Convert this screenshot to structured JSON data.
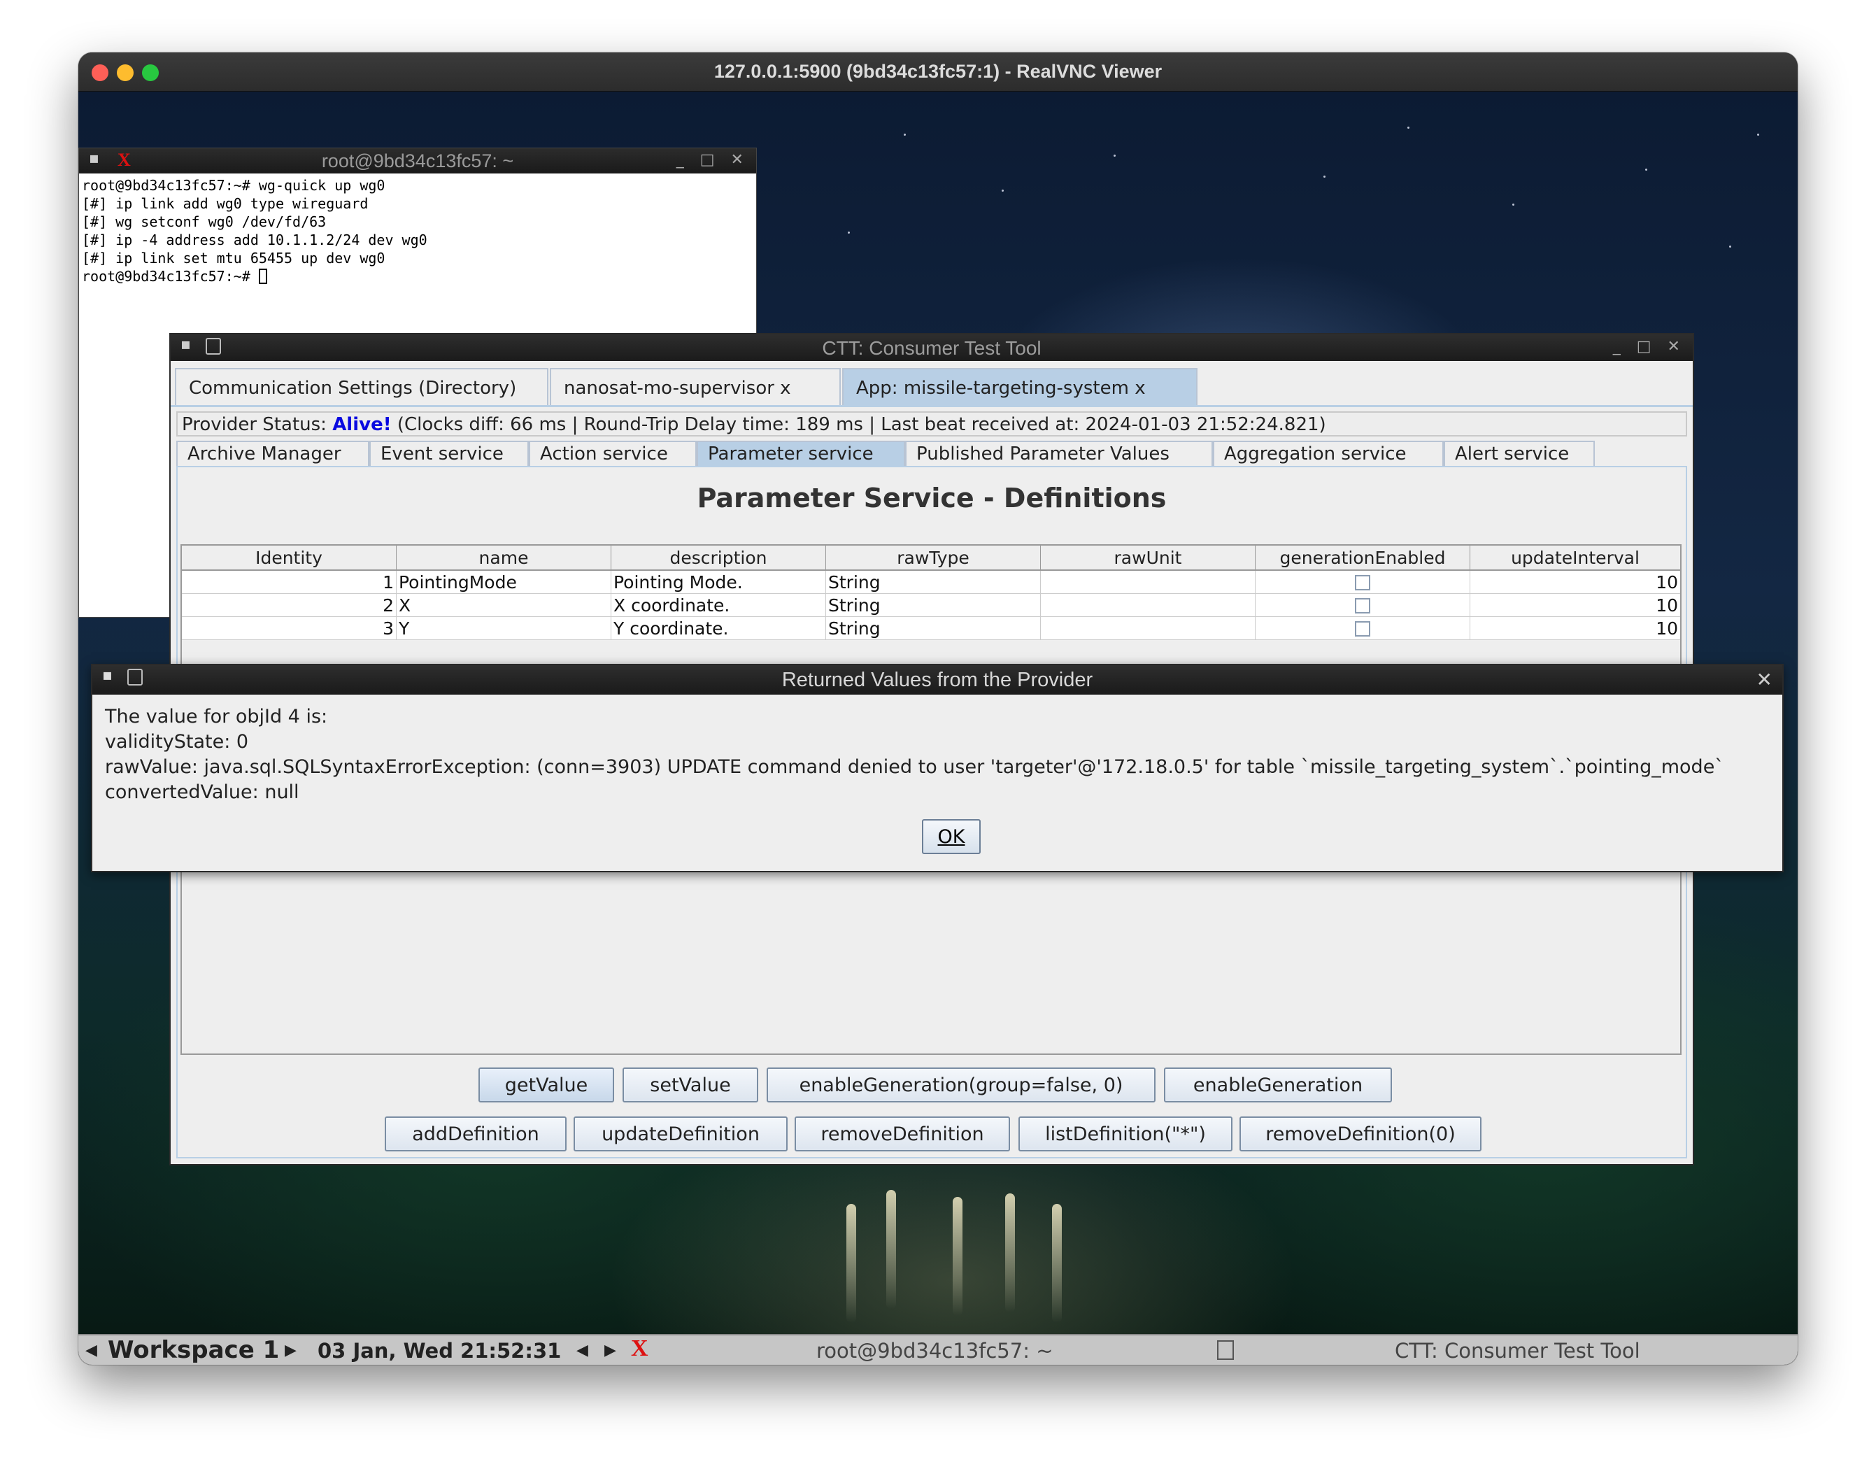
{
  "mac": {
    "title": "127.0.0.1:5900 (9bd34c13fc57:1) - RealVNC Viewer"
  },
  "xterm": {
    "title": "root@9bd34c13fc57: ~",
    "lines": [
      "root@9bd34c13fc57:~# wg-quick up wg0",
      "[#] ip link add wg0 type wireguard",
      "[#] wg setconf wg0 /dev/fd/63",
      "[#] ip -4 address add 10.1.1.2/24 dev wg0",
      "[#] ip link set mtu 65455 up dev wg0",
      "root@9bd34c13fc57:~# "
    ]
  },
  "ctt": {
    "title": "CTT: Consumer Test Tool",
    "tabs": [
      "Communication Settings (Directory)",
      "nanosat-mo-supervisor x",
      "App: missile-targeting-system x"
    ],
    "status": {
      "prefix": "Provider Status: ",
      "state": "Alive!",
      "details": " (Clocks diff: 66 ms | Round-Trip Delay time: 189 ms | Last beat received at: 2024-01-03 21:52:24.821)"
    },
    "service_tabs": [
      "Archive Manager",
      "Event service",
      "Action service",
      "Parameter service",
      "Published Parameter Values",
      "Aggregation service",
      "Alert service"
    ],
    "panel_title": "Parameter Service - Definitions",
    "table": {
      "columns": [
        "Identity",
        "name",
        "description",
        "rawType",
        "rawUnit",
        "generationEnabled",
        "updateInterval"
      ],
      "rows": [
        {
          "identity": "1",
          "name": "PointingMode",
          "description": "Pointing Mode.",
          "rawType": "String",
          "rawUnit": "",
          "generationEnabled": false,
          "updateInterval": "10"
        },
        {
          "identity": "2",
          "name": "X",
          "description": "X coordinate.",
          "rawType": "String",
          "rawUnit": "",
          "generationEnabled": false,
          "updateInterval": "10"
        },
        {
          "identity": "3",
          "name": "Y",
          "description": "Y coordinate.",
          "rawType": "String",
          "rawUnit": "",
          "generationEnabled": false,
          "updateInterval": "10"
        }
      ]
    },
    "buttons_row1": [
      "getValue",
      "setValue",
      "enableGeneration(group=false, 0)",
      "enableGeneration"
    ],
    "buttons_row2": [
      "addDefinition",
      "updateDefinition",
      "removeDefinition",
      "listDefinition(\"*\")",
      "removeDefinition(0)"
    ]
  },
  "dialog": {
    "title": "Returned Values from the Provider",
    "lines": [
      "The value for objId 4 is:",
      "validityState: 0",
      "rawValue: java.sql.SQLSyntaxErrorException: (conn=3903) UPDATE command denied to user 'targeter'@'172.18.0.5' for table `missile_targeting_system`.`pointing_mode`",
      "convertedValue: null"
    ],
    "ok_label": "OK"
  },
  "taskbar": {
    "workspace": "Workspace 1",
    "datetime": "03 Jan, Wed 21:52:31",
    "task1": "root@9bd34c13fc57: ~",
    "task2": "CTT: Consumer Test Tool"
  },
  "colors": {
    "accent_tab": "#b8cfe5",
    "alive": "#0a0ae0"
  }
}
